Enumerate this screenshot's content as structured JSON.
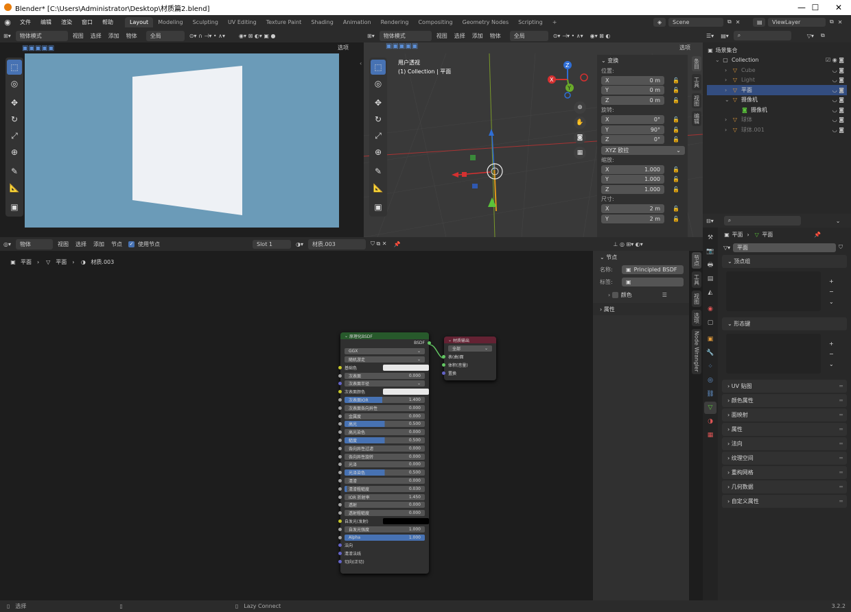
{
  "window": {
    "title": "Blender* [C:\\Users\\Administrator\\Desktop\\材质篇2.blend]",
    "minimize": "—",
    "maximize": "☐",
    "close": "✕"
  },
  "menus": [
    "文件",
    "编辑",
    "渲染",
    "窗口",
    "帮助"
  ],
  "workspaces": [
    "Layout",
    "Modeling",
    "Sculpting",
    "UV Editing",
    "Texture Paint",
    "Shading",
    "Animation",
    "Rendering",
    "Compositing",
    "Geometry Nodes",
    "Scripting"
  ],
  "add_workspace": "+",
  "scene": "Scene",
  "view_layer": "ViewLayer",
  "left_view": {
    "mode": "物体模式",
    "menus": [
      "视图",
      "选择",
      "添加",
      "物体"
    ],
    "transform": "全局",
    "options": "选项"
  },
  "viewport": {
    "mode": "物体模式",
    "menus": [
      "视图",
      "选择",
      "添加",
      "物体"
    ],
    "transform": "全局",
    "options": "选项",
    "overlay1": "用户透视",
    "overlay2": "(1) Collection | 平面",
    "axis": {
      "x": "X",
      "y": "Y",
      "z": "Z"
    },
    "tabs": [
      "条目",
      "工具",
      "视图",
      "编辑"
    ]
  },
  "npanel": {
    "title": "变换",
    "location_label": "位置:",
    "rotation_label": "旋转:",
    "scale_label": "缩放:",
    "dims_label": "尺寸:",
    "location": [
      {
        "axis": "X",
        "value": "0 m"
      },
      {
        "axis": "Y",
        "value": "0 m"
      },
      {
        "axis": "Z",
        "value": "0 m"
      }
    ],
    "rotation": [
      {
        "axis": "X",
        "value": "0°"
      },
      {
        "axis": "Y",
        "value": "90°"
      },
      {
        "axis": "Z",
        "value": "0°"
      }
    ],
    "rot_mode": "XYZ 欧拉",
    "scale": [
      {
        "axis": "X",
        "value": "1.000"
      },
      {
        "axis": "Y",
        "value": "1.000"
      },
      {
        "axis": "Z",
        "value": "1.000"
      }
    ],
    "dims": [
      {
        "axis": "X",
        "value": "2 m"
      },
      {
        "axis": "Y",
        "value": "2 m"
      }
    ]
  },
  "outliner": {
    "root": "场景集合",
    "items": [
      {
        "name": "Collection",
        "indent": 0,
        "dim": false,
        "sel": false
      },
      {
        "name": "Cube",
        "indent": 1,
        "dim": true,
        "sel": false
      },
      {
        "name": "Light",
        "indent": 1,
        "dim": true,
        "sel": false
      },
      {
        "name": "平面",
        "indent": 1,
        "dim": false,
        "sel": true
      },
      {
        "name": "摄像机",
        "indent": 1,
        "dim": false,
        "sel": false
      },
      {
        "name": "摄像机",
        "indent": 2,
        "dim": false,
        "sel": false
      },
      {
        "name": "球体",
        "indent": 1,
        "dim": true,
        "sel": false
      },
      {
        "name": "球体.001",
        "indent": 1,
        "dim": true,
        "sel": false
      }
    ]
  },
  "node_editor": {
    "type": "物体",
    "menus": [
      "视图",
      "选择",
      "添加",
      "节点"
    ],
    "use_nodes": "使用节点",
    "slot": "Slot 1",
    "material": "材质.003",
    "breadcrumb": [
      "平面",
      "平面",
      "材质.003"
    ],
    "tabs": [
      "节点",
      "工具",
      "视图",
      "选项",
      "Node Wrangler"
    ],
    "side": {
      "title": "节点",
      "name_label": "名称:",
      "name_value": "Principled BSDF",
      "label_label": "标签:",
      "color": "颜色",
      "props": "属性"
    }
  },
  "bsdf_node": {
    "title": "原理化BSDF",
    "output": "BSDF",
    "dist": "GGX",
    "sss_method": "随机游走",
    "rows": [
      {
        "label": "基础色",
        "type": "color",
        "color": "#e8e8e8",
        "sock": "#c7c729"
      },
      {
        "label": "次表面",
        "value": "0.000",
        "fill": 0,
        "sock": "#a1a1a1"
      },
      {
        "label": "次表面半径",
        "type": "dropdown",
        "sock": "#6363c7"
      },
      {
        "label": "次表面颜色",
        "type": "color",
        "color": "#e8e8e8",
        "sock": "#c7c729"
      },
      {
        "label": "次表面IOR",
        "value": "1.400",
        "fill": 0.47,
        "sock": "#a1a1a1"
      },
      {
        "label": "次表面各向异性",
        "value": "0.000",
        "fill": 0,
        "sock": "#a1a1a1"
      },
      {
        "label": "金属度",
        "value": "0.000",
        "fill": 0,
        "sock": "#a1a1a1"
      },
      {
        "label": "高光",
        "value": "0.500",
        "fill": 0.5,
        "sock": "#a1a1a1"
      },
      {
        "label": "高光染色",
        "value": "0.000",
        "fill": 0,
        "sock": "#a1a1a1"
      },
      {
        "label": "糙度",
        "value": "0.500",
        "fill": 0.5,
        "sock": "#a1a1a1"
      },
      {
        "label": "各向异性过滤",
        "value": "0.000",
        "fill": 0,
        "sock": "#a1a1a1"
      },
      {
        "label": "各向异性旋转",
        "value": "0.000",
        "fill": 0,
        "sock": "#a1a1a1"
      },
      {
        "label": "光泽",
        "value": "0.000",
        "fill": 0,
        "sock": "#a1a1a1"
      },
      {
        "label": "光泽染色",
        "value": "0.500",
        "fill": 0.5,
        "sock": "#a1a1a1"
      },
      {
        "label": "清漆",
        "value": "0.000",
        "fill": 0,
        "sock": "#a1a1a1"
      },
      {
        "label": "清漆粗糙度",
        "value": "0.030",
        "fill": 0.03,
        "sock": "#a1a1a1"
      },
      {
        "label": "IOR 折射率",
        "value": "1.450",
        "fill": 0,
        "sock": "#a1a1a1"
      },
      {
        "label": "透射",
        "value": "0.000",
        "fill": 0,
        "sock": "#a1a1a1"
      },
      {
        "label": "透射粗糙度",
        "value": "0.000",
        "fill": 0,
        "sock": "#a1a1a1"
      },
      {
        "label": "自发光(发射)",
        "type": "color",
        "color": "#000000",
        "sock": "#c7c729"
      },
      {
        "label": "自发光强度",
        "value": "1.000",
        "fill": 0,
        "sock": "#a1a1a1"
      },
      {
        "label": "Alpha",
        "value": "1.000",
        "fill": 1,
        "sock": "#a1a1a1"
      },
      {
        "label": "法向",
        "type": "plain",
        "sock": "#6363c7"
      },
      {
        "label": "清漆法线",
        "type": "plain",
        "sock": "#6363c7"
      },
      {
        "label": "切向(正切)",
        "type": "plain",
        "sock": "#6363c7"
      }
    ]
  },
  "output_node": {
    "title": "材质输出",
    "target": "全部",
    "inputs": [
      {
        "label": "表(曲)面",
        "sock": "#63c763"
      },
      {
        "label": "体积(音量)",
        "sock": "#63c763"
      },
      {
        "label": "置换",
        "sock": "#6363c7"
      }
    ]
  },
  "properties": {
    "obj": "平面",
    "data": "平面",
    "data_name": "平面",
    "sections": [
      "UV 贴图",
      "颜色属性",
      "面映射",
      "属性",
      "法向",
      "纹理空间",
      "重构网格",
      "几何数据",
      "自定义属性"
    ],
    "vgroups": "顶点组",
    "shapekeys": "形态键"
  },
  "status": {
    "select": "选择",
    "lazy": "Lazy Connect",
    "version": "3.2.2"
  }
}
